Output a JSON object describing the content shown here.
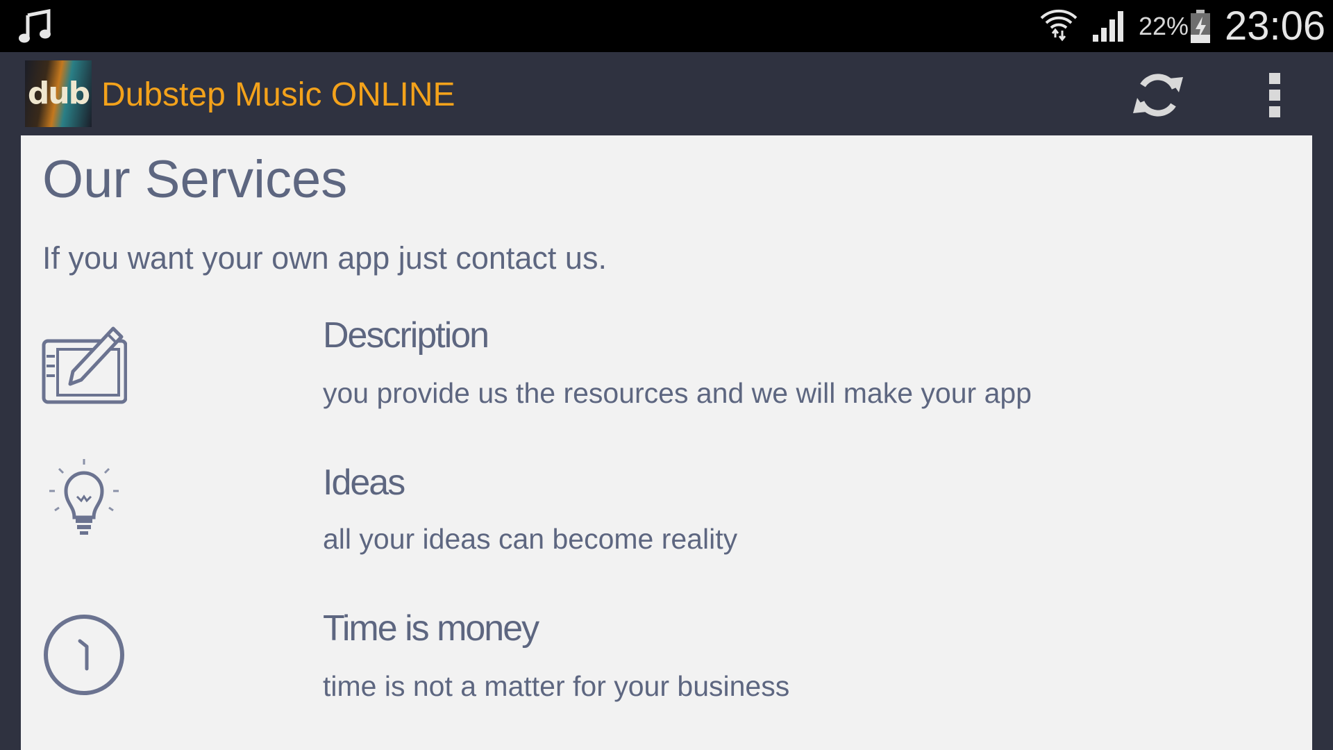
{
  "status_bar": {
    "battery_percent": "22%",
    "time": "23:06",
    "icons": [
      "music-note-icon",
      "wifi-icon",
      "signal-icon",
      "battery-charging-icon"
    ]
  },
  "action_bar": {
    "app_title": "Dubstep Music ONLINE",
    "logo_text": "dub",
    "icons": [
      "refresh-icon",
      "overflow-menu-icon"
    ]
  },
  "page": {
    "title": "Our Services",
    "subtitle": "If you want your own app just contact us."
  },
  "services": [
    {
      "heading": "Description",
      "description": "you provide us the resources and we will make your app",
      "icon": "tablet-pen-icon"
    },
    {
      "heading": "Ideas",
      "description": "all your ideas can become reality",
      "icon": "lightbulb-icon"
    },
    {
      "heading": "Time is money",
      "description": "time is not a matter for your business",
      "icon": "clock-icon"
    }
  ],
  "colors": {
    "status_bar_bg": "#000000",
    "action_bar_bg": "#2f3240",
    "title_accent": "#f3a21b",
    "content_bg": "#f2f2f2",
    "text": "#5d6680"
  }
}
